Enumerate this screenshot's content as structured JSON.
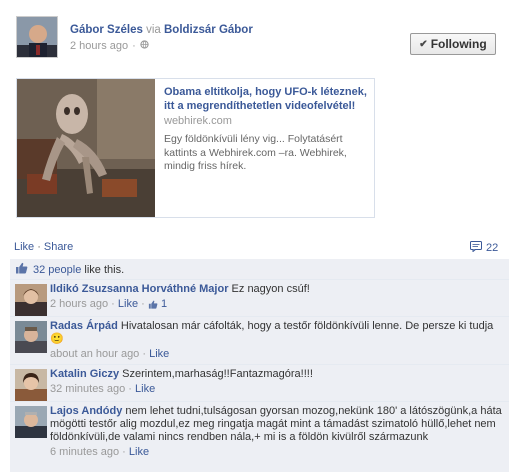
{
  "post": {
    "author": "Gábor Széles",
    "via_word": "via",
    "via_author": "Boldizsár Gábor",
    "time": "2 hours ago",
    "meta_sep": "·",
    "following_label": "Following"
  },
  "link": {
    "title": "Obama eltitkolja, hogy UFO-k léteznek, itt a megrendíthetetlen videofelvétel!",
    "domain": "webhirek.com",
    "description": "Egy földönkívüli lény vig... Folytatásért kattints a Webhirek.com –ra. Webhirek, mindig friss hírek."
  },
  "actions": {
    "like": "Like",
    "dot": "·",
    "share": "Share",
    "comment_count": "22"
  },
  "likes": {
    "people": "32 people",
    "suffix": "like this."
  },
  "comments": [
    {
      "author": "Ildikó Zsuzsanna Horváthné Major",
      "text": "Ez nagyon csúf!",
      "time": "2 hours ago",
      "like": "Like",
      "likes": "1"
    },
    {
      "author": "Radas Árpád",
      "text": "Hivatalosan már cáfolták, hogy a testőr földönkívüli lenne. De persze ki tudja",
      "emoji": "🙂",
      "time": "about an hour ago",
      "like": "Like"
    },
    {
      "author": "Katalin Giczy",
      "text": "Szerintem,marhaság!!Fantazmagóra!!!!",
      "time": "32 minutes ago",
      "like": "Like"
    },
    {
      "author": "Lajos Andódy",
      "text": "nem lehet tudni,tulságosan gyorsan mozog,nekünk 180' a látószögünk,a háta mögötti testőr alig mozdul,ez meg ringatja magát mint a támadást szimatoló hüllő,lehet nem földönkívüli,de valami nincs rendben nála,+ mi is a földön kivülről származunk",
      "time": "6 minutes ago",
      "like": "Like"
    }
  ]
}
